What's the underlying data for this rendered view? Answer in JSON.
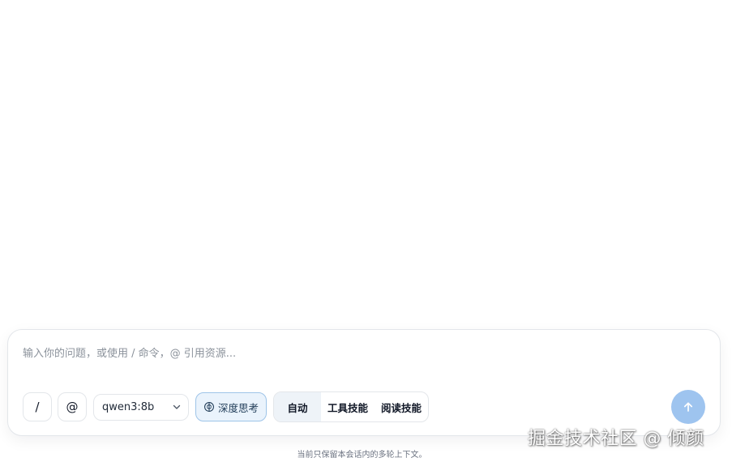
{
  "composer": {
    "placeholder": "输入你的问题，或使用 / 命令，@ 引用资源...",
    "slash_label": "/",
    "at_label": "@",
    "model_value": "qwen3:8b",
    "think_label": "深度思考",
    "modes": [
      {
        "label": "自动",
        "active": true
      },
      {
        "label": "工具技能",
        "active": false
      },
      {
        "label": "阅读技能",
        "active": false
      }
    ]
  },
  "footnote": "当前只保留本会话内的多轮上下文。",
  "watermark": "掘金技术社区 @ 倾颜",
  "colors": {
    "accent": "#9ec4ef",
    "think_bg": "#eaf3fc",
    "think_border": "#9ec4e8",
    "active_mode_bg": "#eef3f8"
  },
  "icons": {
    "model_chevron": "chevron-down-icon",
    "think": "brain-icon",
    "send": "arrow-up-icon"
  }
}
